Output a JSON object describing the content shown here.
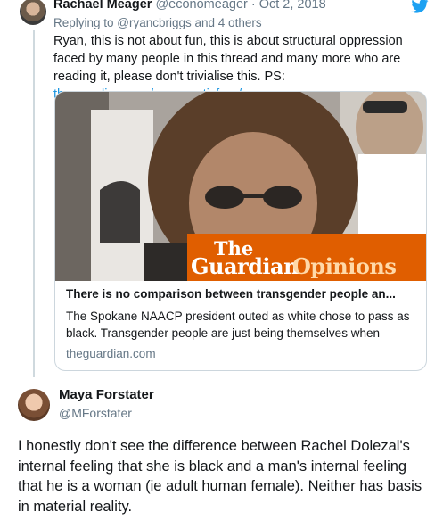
{
  "tweet1": {
    "name": "Rachael Meager",
    "meta": " @economeager · Oct 2, 2018",
    "reply_to": "Replying to @ryancbriggs and 4 others",
    "text": "Ryan, this is not about fun, this is about structural oppression faced by many people in this thread and many more who are reading it, please don't trivialise this. PS: ",
    "link": "theguardian.com/commentisfree/...",
    "avatar_icon": "user-avatar-icon",
    "bird_icon": "twitter-bird-icon",
    "colors": {
      "link": "#1b95e0",
      "muted": "#657786",
      "guardian_orange": "#e05e00"
    }
  },
  "card": {
    "brand_the": "The",
    "brand_guardian": "Guardian",
    "brand_opinions": "Opinions",
    "title": "There is no comparison between transgender people an...",
    "description": "The Spokane NAACP president outed as white chose to pass as black. Transgender people are just being themselves when",
    "domain": "theguardian.com"
  },
  "tweet2": {
    "name": "Maya Forstater",
    "handle": "@MForstater",
    "text": "I honestly don't see the difference between Rachel Dolezal's internal feeling that she is black and a man's internal feeling that he is a woman (ie adult human female). Neither has basis in material reality."
  }
}
